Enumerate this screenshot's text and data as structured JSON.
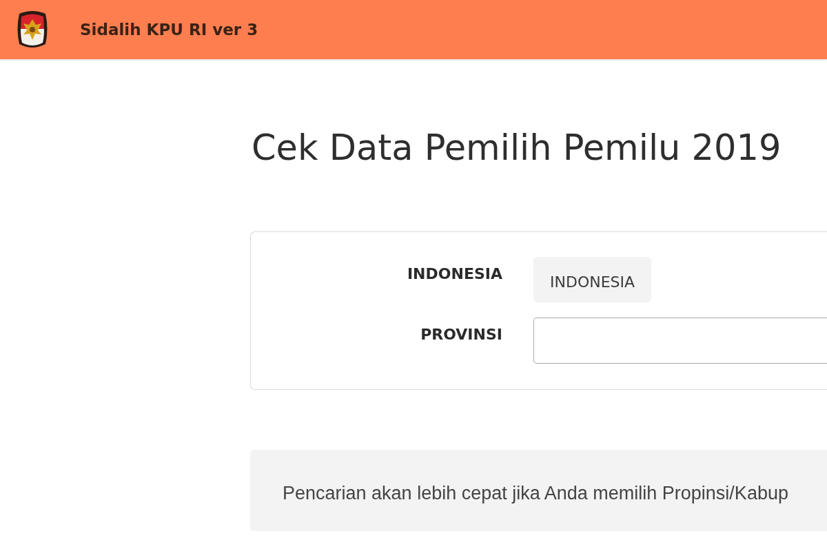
{
  "header": {
    "title": "Sidalih KPU RI ver 3"
  },
  "page": {
    "title": "Cek Data Pemilih Pemilu 2019"
  },
  "form": {
    "fields": [
      {
        "kind": "readonly",
        "label": "INDONESIA",
        "value": "INDONESIA"
      },
      {
        "kind": "input",
        "label": "PROVINSI"
      }
    ]
  },
  "notice": {
    "text": "Pencarian akan lebih cepat jika Anda memilih Propinsi/Kabup"
  }
}
